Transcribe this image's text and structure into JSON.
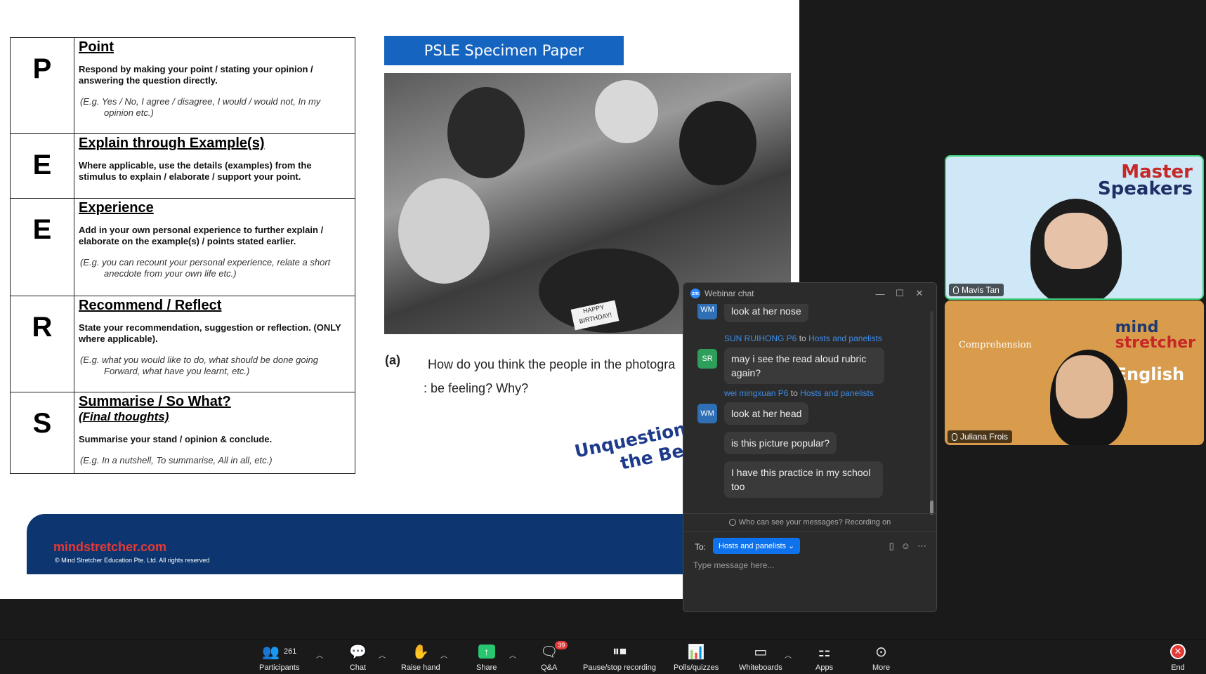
{
  "slide": {
    "rows": [
      {
        "letter": "P",
        "title": "Point",
        "subtitle": "",
        "body": "Respond by making your point / stating your opinion / answering the question directly.",
        "example_1": "(E.g. Yes / No, I agree / disagree, I would / would not, In my",
        "example_2": "opinion etc.)"
      },
      {
        "letter": "E",
        "title": "Explain through Example(s)",
        "subtitle": "",
        "body": "Where applicable, use the details (examples) from the stimulus to explain / elaborate / support your point.",
        "example_1": "",
        "example_2": ""
      },
      {
        "letter": "E",
        "title": "Experience",
        "subtitle": "",
        "body": "Add in your own personal experience to further explain / elaborate on the example(s) / points stated earlier.",
        "example_1": "(E.g. you can recount your personal experience, relate a short",
        "example_2": "anecdote from your own life etc.)"
      },
      {
        "letter": "R",
        "title": "Recommend / Reflect",
        "subtitle": "",
        "body": "State your recommendation, suggestion or reflection. (ONLY where applicable).",
        "example_1": "(E.g. what you would like to do, what should be done going",
        "example_2": "Forward, what have you learnt, etc.)"
      },
      {
        "letter": "S",
        "title": "Summarise / So What?",
        "subtitle": "(Final thoughts)",
        "body": "Summarise your stand / opinion & conclude.",
        "example_1": "(E.g. In a nutshell, To summarise, All in all, etc.)",
        "example_2": ""
      }
    ],
    "banner": "PSLE Specimen Paper",
    "cake_sign": "HAPPY BIRTHDAY!",
    "question_label": "(a)",
    "question_line_1": "How do you think the people in the photogra",
    "question_line_2": ": be feeling? Why?",
    "tagline_1": "Unquestion",
    "tagline_2": "the Be",
    "brand": "mindstretcher.com",
    "copyright": "© Mind Stretcher Education Pte. Ltd. All rights reserved"
  },
  "tiles": {
    "tile_1_name": "Mavis Tan",
    "tile_1_logo_a": "Master",
    "tile_1_logo_b": "Speakers",
    "tile_2_name": "Juliana Frois",
    "tile_2_logo_a": "mind",
    "tile_2_logo_b": "stretcher",
    "tile_2_logo_c": "English",
    "tile_2_book": "Comprehension"
  },
  "chat": {
    "title": "Webinar chat",
    "messages": [
      {
        "initials": "WM",
        "text": "look at her nose"
      },
      {
        "initials": "SR",
        "sender": "SUN RUIHONG P6",
        "to_word": "to",
        "recipient": "Hosts and panelists",
        "text": "may i see the read aloud rubric again?"
      },
      {
        "initials": "WM",
        "sender": "wei mingxuan P6",
        "to_word": "to",
        "recipient": "Hosts and panelists",
        "text": "look at her head"
      },
      {
        "text": "is this picture popular?"
      },
      {
        "text": "I have this practice in my school too"
      }
    ],
    "privacy": "Who can see your messages? Recording on",
    "to_label": "To:",
    "to_value": "Hosts and panelists",
    "placeholder": "Type message here..."
  },
  "toolbar": {
    "participants_count": "261",
    "participants": "Participants",
    "chat": "Chat",
    "raise_hand": "Raise hand",
    "share": "Share",
    "qa": "Q&A",
    "qa_badge": "39",
    "record": "Pause/stop recording",
    "polls": "Polls/quizzes",
    "whiteboards": "Whiteboards",
    "apps": "Apps",
    "more": "More",
    "end": "End"
  }
}
